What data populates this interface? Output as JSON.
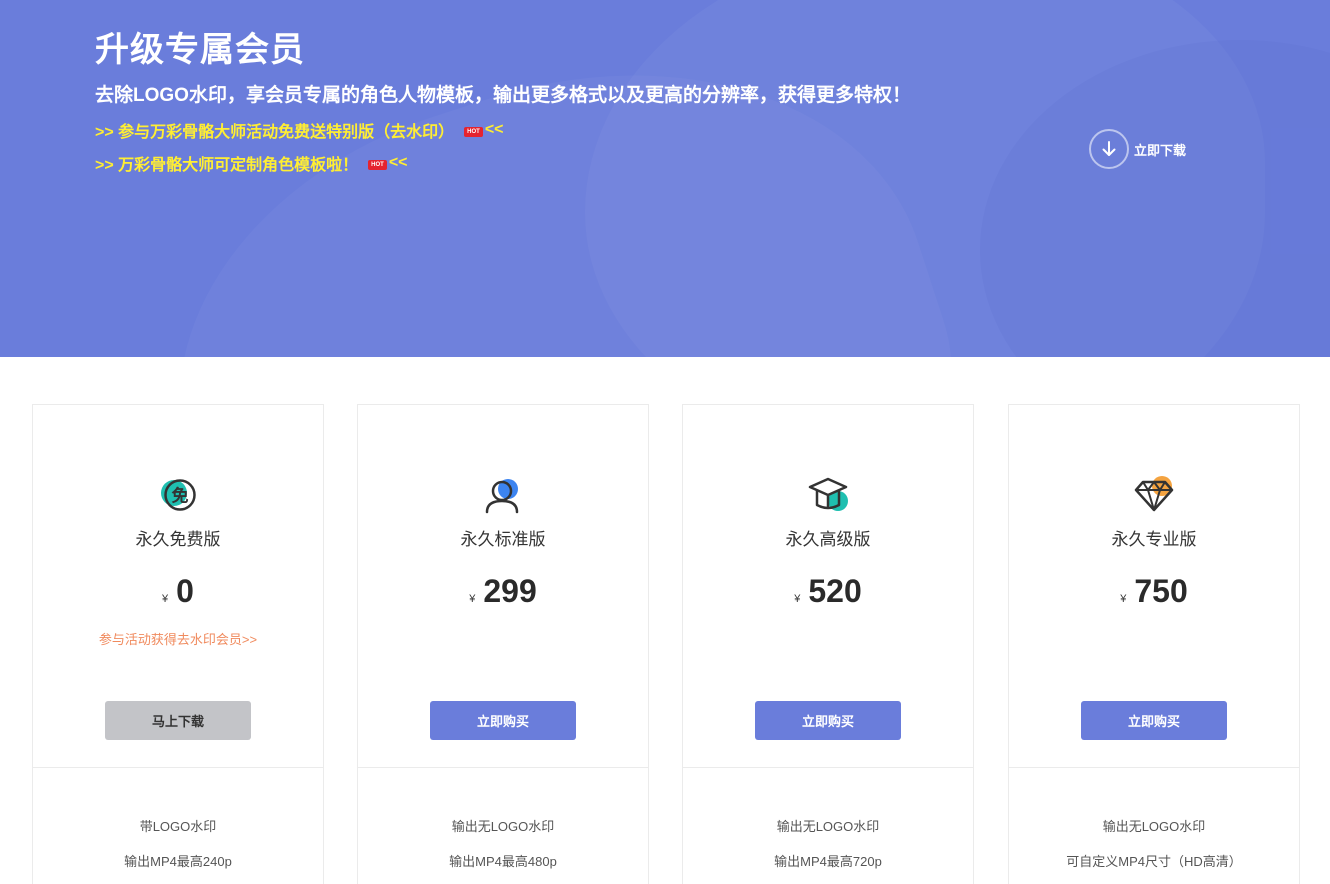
{
  "hero": {
    "title": "升级专属会员",
    "subtitle": "去除LOGO水印，享会员专属的角色人物模板，输出更多格式以及更高的分辨率，获得更多特权！",
    "promos": [
      {
        "text": ">> 参与万彩骨骼大师活动免费送特别版（去水印）",
        "badge": "HOT",
        "suffix": "<<"
      },
      {
        "text": ">> 万彩骨骼大师可定制角色模板啦！",
        "badge": "HOT",
        "suffix": "<<"
      }
    ],
    "download_label": "立即下载",
    "colors": {
      "background": "#6a7ddb",
      "promo_text": "#ffee33",
      "badge": "#e5232f"
    }
  },
  "plans": [
    {
      "icon": "free-badge-icon",
      "name": "永久免费版",
      "currency": "¥",
      "price": "0",
      "promo_link": "参与活动获得去水印会员>>",
      "button": "马上下载",
      "features": [
        "带LOGO水印",
        "输出MP4最高240p"
      ]
    },
    {
      "icon": "user-icon",
      "name": "永久标准版",
      "currency": "¥",
      "price": "299",
      "button": "立即购买",
      "features": [
        "输出无LOGO水印",
        "输出MP4最高480p"
      ]
    },
    {
      "icon": "graduation-cap-icon",
      "name": "永久高级版",
      "currency": "¥",
      "price": "520",
      "button": "立即购买",
      "features": [
        "输出无LOGO水印",
        "输出MP4最高720p"
      ]
    },
    {
      "icon": "diamond-icon",
      "name": "永久专业版",
      "currency": "¥",
      "price": "750",
      "button": "立即购买",
      "features": [
        "输出无LOGO水印",
        "可自定义MP4尺寸（HD高清）"
      ]
    }
  ],
  "colors": {
    "accent": "#6a7ddb",
    "free_button": "#c3c4c8",
    "promo_link": "#f08a5d",
    "icon_teal": "#1fbfb0",
    "icon_blue": "#3c84f0",
    "icon_orange": "#f4a340"
  }
}
